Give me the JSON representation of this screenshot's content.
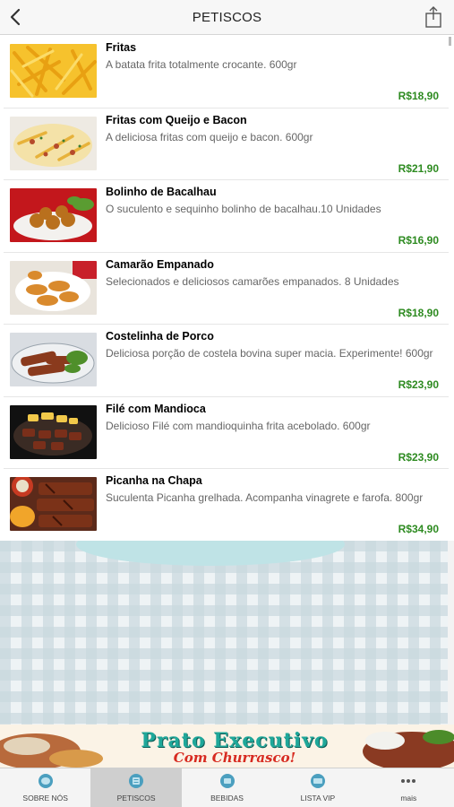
{
  "header": {
    "title": "PETISCOS"
  },
  "items": [
    {
      "name": "Fritas",
      "description": "A batata frita totalmente crocante. 600gr",
      "price": "R$18,90"
    },
    {
      "name": "Fritas com Queijo e Bacon",
      "description": "A deliciosa fritas com queijo e bacon. 600gr",
      "price": "R$21,90"
    },
    {
      "name": "Bolinho de Bacalhau",
      "description": "O suculento e sequinho bolinho de bacalhau.10 Unidades",
      "price": "R$16,90"
    },
    {
      "name": "Camarão Empanado",
      "description": "Selecionados e deliciosos camarões empanados. 8 Unidades",
      "price": "R$18,90"
    },
    {
      "name": "Costelinha de Porco",
      "description": "Deliciosa porção de costela bovina super macia. Experimente! 600gr",
      "price": "R$23,90"
    },
    {
      "name": "Filé com Mandioca",
      "description": "Delicioso Filé com mandioquinha frita acebolado. 600gr",
      "price": "R$23,90"
    },
    {
      "name": "Picanha na Chapa",
      "description": "Suculenta Picanha grelhada. Acompanha vinagrete e farofa. 800gr",
      "price": "R$34,90"
    }
  ],
  "banner": {
    "title": "Prato Executivo",
    "subtitle": "Com Churrasco!"
  },
  "tabs": [
    {
      "label": "SOBRE NÓS",
      "icon": "info-circle-icon"
    },
    {
      "label": "PETISCOS",
      "icon": "menu-list-icon"
    },
    {
      "label": "BEBIDAS",
      "icon": "drinks-icon"
    },
    {
      "label": "LISTA VIP",
      "icon": "vip-ticket-icon"
    },
    {
      "label": "mais",
      "icon": "more-dots-icon"
    }
  ],
  "colors": {
    "price": "#2e8b21",
    "active_tab": "#cfcfcf",
    "banner_title": "#1fa89a",
    "banner_subtitle": "#d72a20"
  }
}
